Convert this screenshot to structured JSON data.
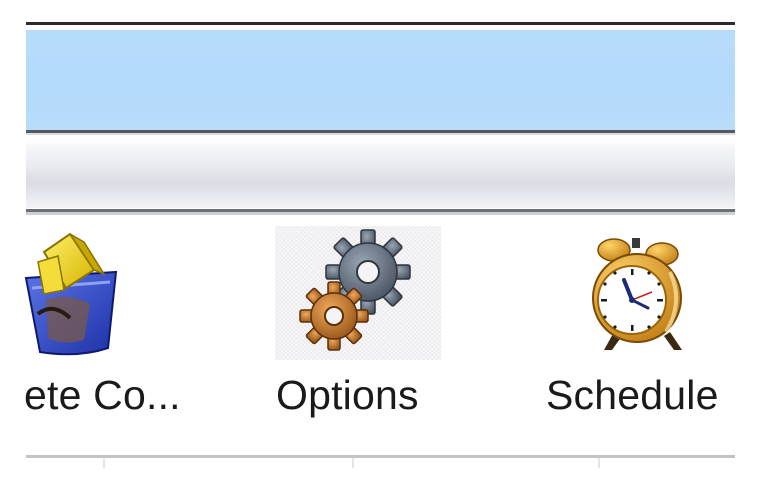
{
  "ribbon": {
    "buttons": [
      {
        "label": "ete Co...",
        "icon": "recycle-bin-icon"
      },
      {
        "label": "Options",
        "icon": "gears-icon"
      },
      {
        "label": "Schedule",
        "icon": "alarm-clock-icon"
      }
    ]
  },
  "colors": {
    "title_band": "#b4daf9",
    "toolbar_band": "#e3e4ea",
    "accent_gear_dark": "#5a6575",
    "accent_gear_orange": "#b86a1c",
    "clock_gold": "#e7a21f"
  }
}
